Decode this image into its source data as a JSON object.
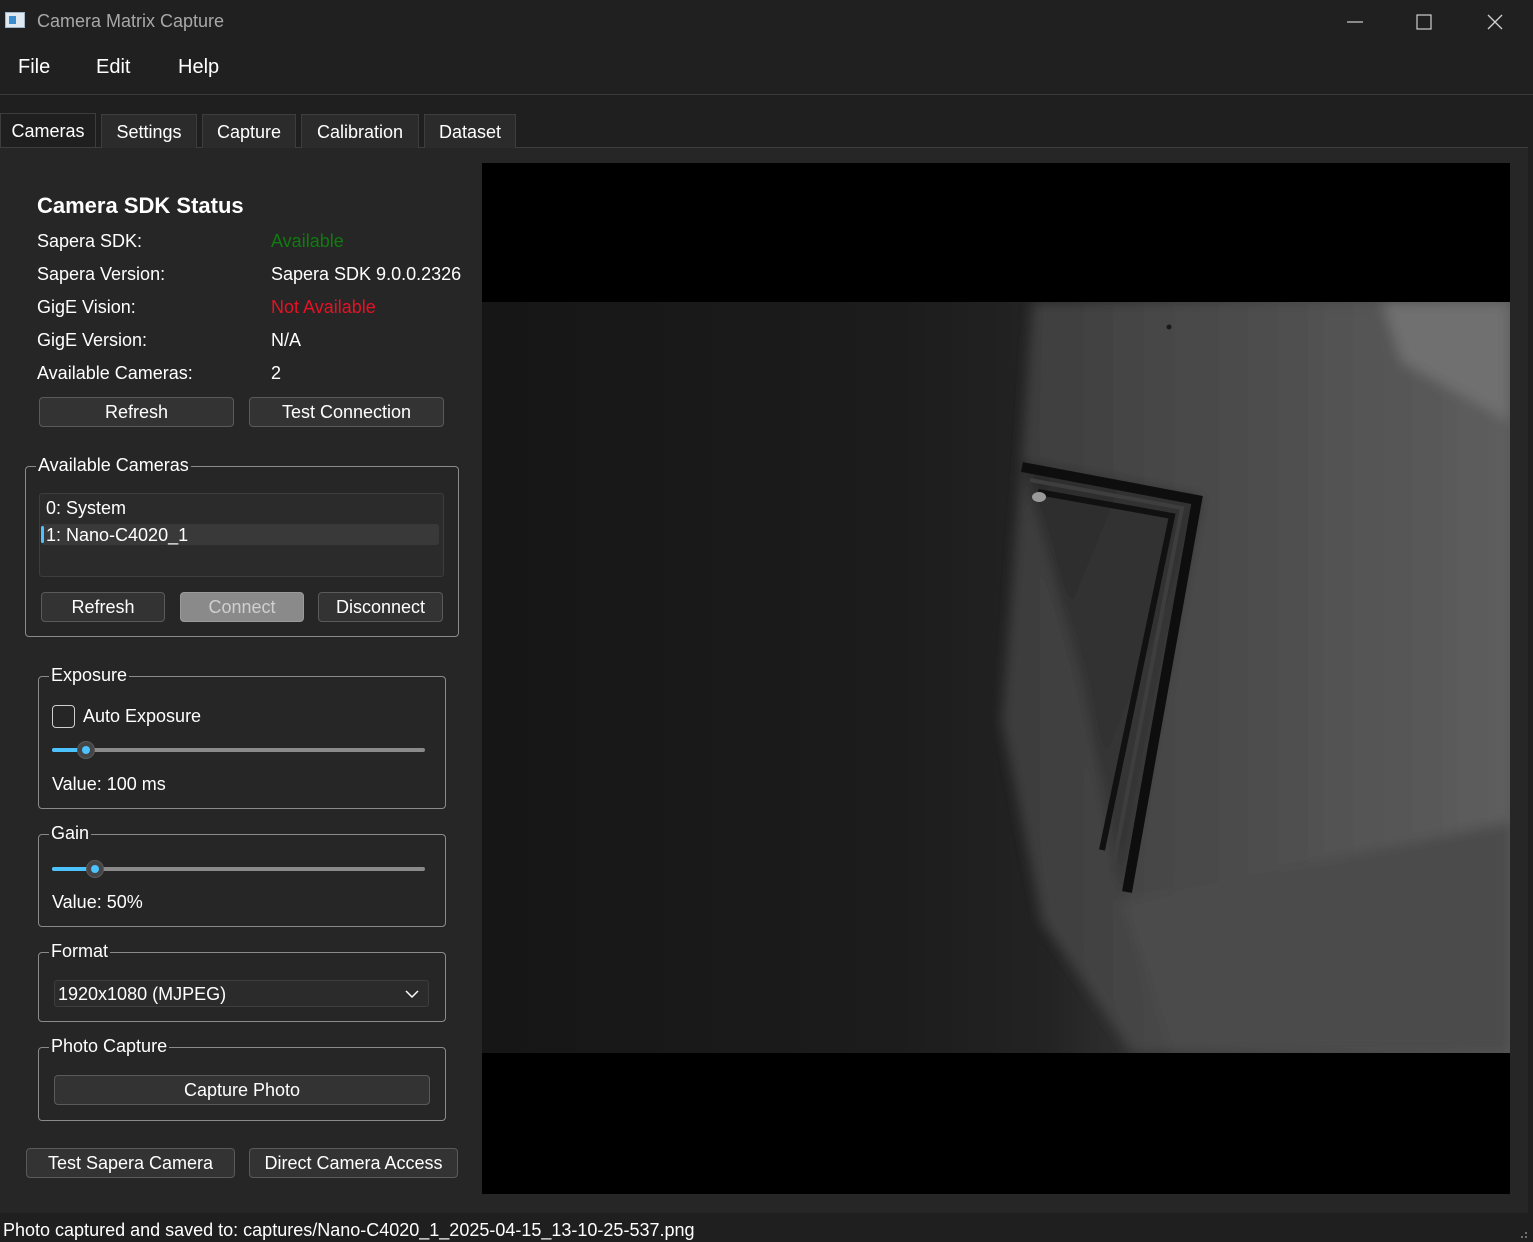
{
  "window": {
    "title": "Camera Matrix Capture"
  },
  "menu": {
    "items": [
      "File",
      "Edit",
      "Help"
    ]
  },
  "tabs": [
    {
      "label": "Cameras",
      "active": true
    },
    {
      "label": "Settings"
    },
    {
      "label": "Capture"
    },
    {
      "label": "Calibration"
    },
    {
      "label": "Dataset"
    }
  ],
  "sdk_status": {
    "heading": "Camera SDK Status",
    "rows": [
      {
        "label": "Sapera SDK:",
        "value": "Available",
        "color": "#0f7b0f"
      },
      {
        "label": "Sapera Version:",
        "value": "Sapera SDK 9.0.0.2326"
      },
      {
        "label": "GigE Vision:",
        "value": "Not Available",
        "color": "#e81123"
      },
      {
        "label": "GigE Version:",
        "value": "N/A"
      },
      {
        "label": "Available Cameras:",
        "value": "2"
      }
    ],
    "refresh_label": "Refresh",
    "test_connection_label": "Test Connection"
  },
  "available_cameras": {
    "title": "Available Cameras",
    "items": [
      "0: System",
      "1: Nano-C4020_1"
    ],
    "selected_index": 1,
    "refresh_label": "Refresh",
    "connect_label": "Connect",
    "disconnect_label": "Disconnect"
  },
  "exposure": {
    "title": "Exposure",
    "auto_label": "Auto Exposure",
    "auto_checked": false,
    "slider_fraction": 0.09,
    "value_text": "Value: 100 ms"
  },
  "gain": {
    "title": "Gain",
    "slider_fraction": 0.115,
    "value_text": "Value: 50%"
  },
  "format": {
    "title": "Format",
    "selected": "1920x1080 (MJPEG)"
  },
  "photo_capture": {
    "title": "Photo Capture",
    "capture_label": "Capture Photo"
  },
  "bottom_buttons": {
    "test_sapera_label": "Test Sapera Camera",
    "direct_access_label": "Direct Camera Access"
  },
  "status_bar": {
    "text": "Photo captured and saved to: captures/Nano-C4020_1_2025-04-15_13-10-25-537.png"
  },
  "colors": {
    "accent": "#4cc2ff",
    "available": "#0f7b0f",
    "not_available": "#e81123"
  }
}
